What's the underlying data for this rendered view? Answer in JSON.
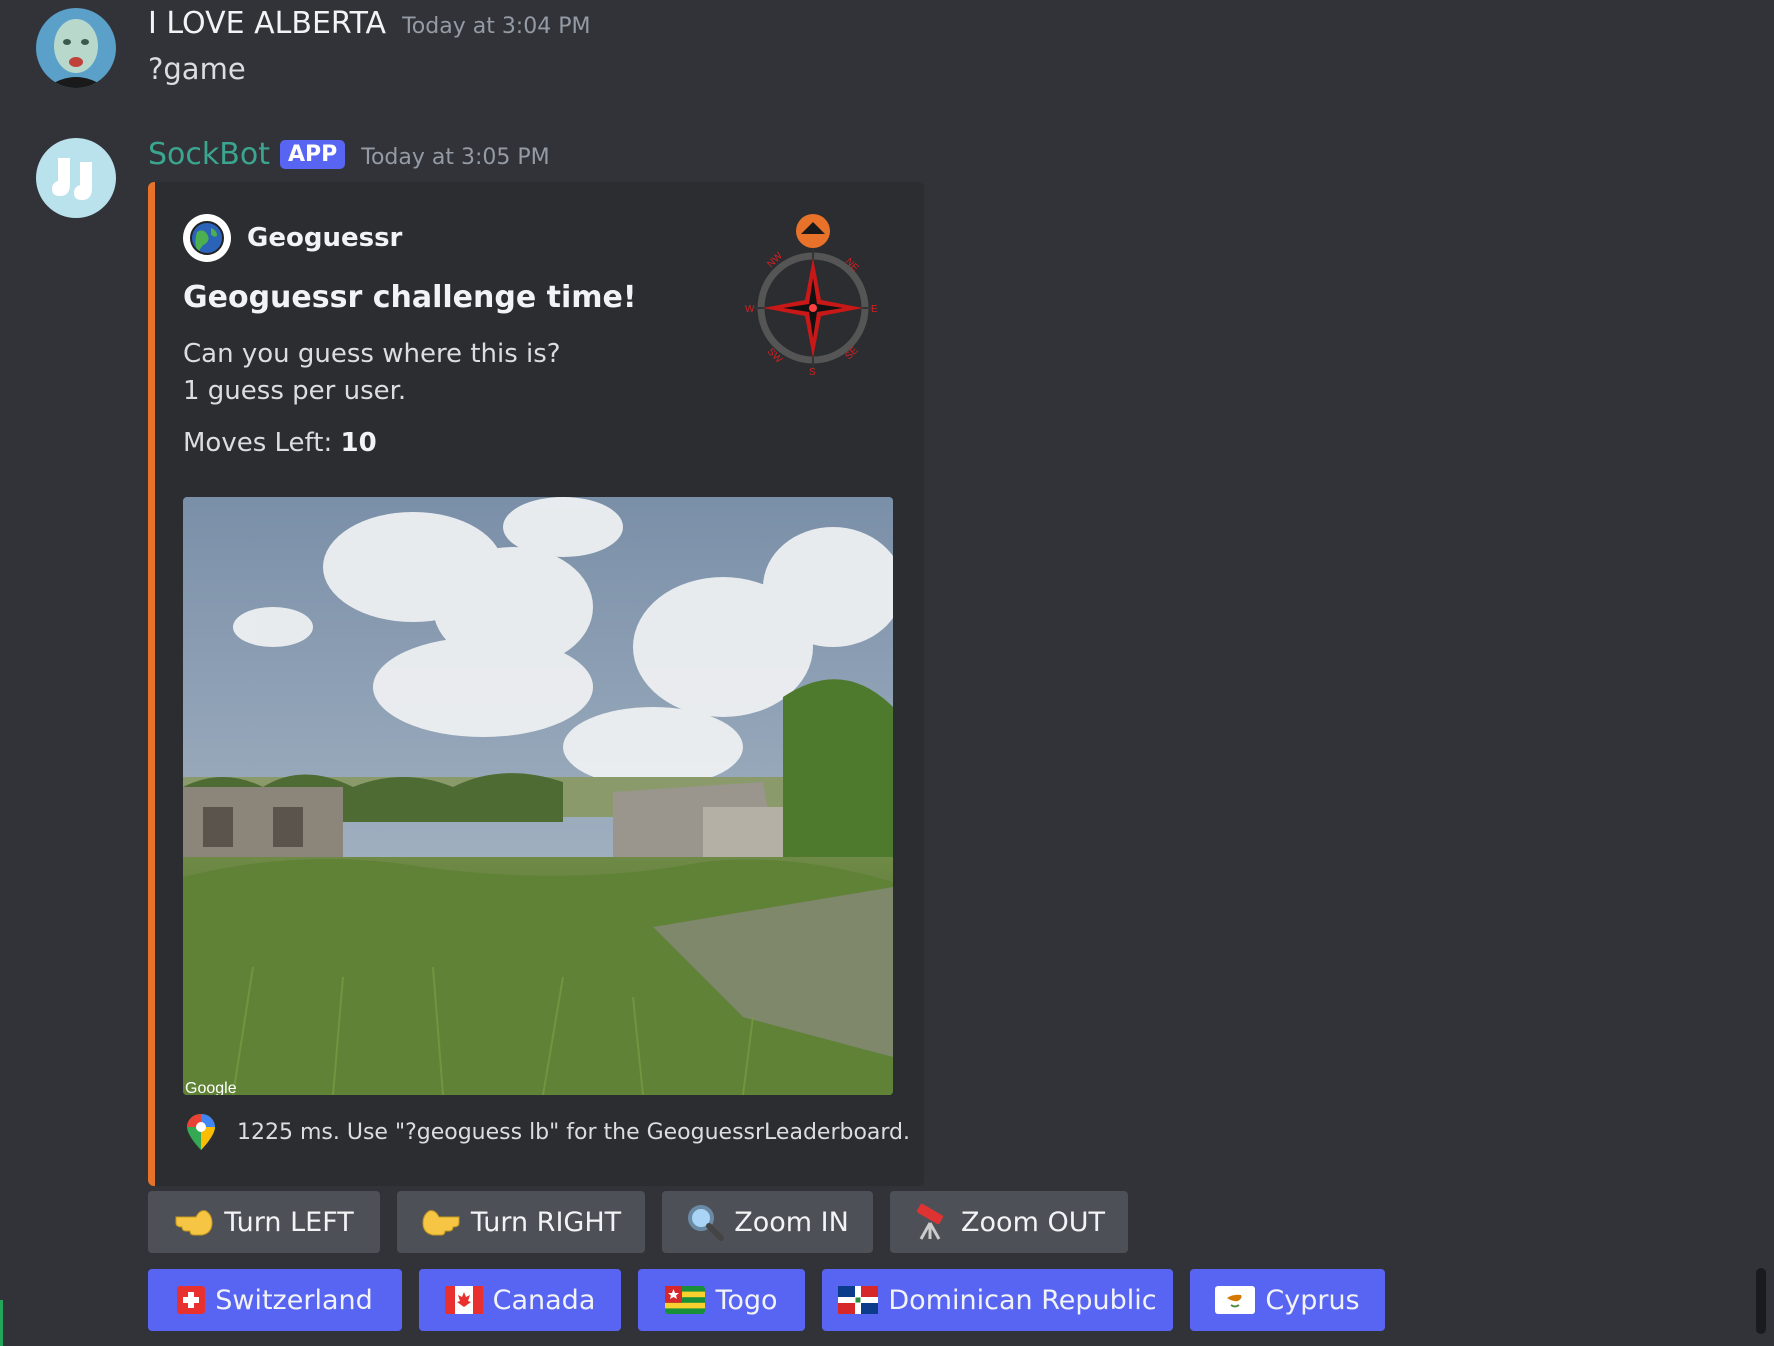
{
  "messages": [
    {
      "author": "I LOVE ALBERTA",
      "timestamp": "Today at 3:04 PM",
      "content": "?game"
    },
    {
      "author": "SockBot",
      "tag": "APP",
      "timestamp": "Today at 3:05 PM",
      "embed": {
        "accent_color": "#e8722a",
        "author_name": "Geoguessr",
        "title": "Geoguessr challenge time!",
        "description": "Can you guess where this is? 1 guess per user.",
        "moves_label": "Moves Left: ",
        "moves_value": "10",
        "footer": "1225 ms. Use \"?geoguess lb\" for the GeoguessrLeaderboard.",
        "compass_labels": [
          "NW",
          "NE",
          "W",
          "E",
          "SW",
          "SE",
          "S"
        ],
        "image_watermark": "Google"
      }
    }
  ],
  "controls": [
    {
      "label": "Turn LEFT",
      "icon": "pointing-left-hand-icon"
    },
    {
      "label": "Turn RIGHT",
      "icon": "pointing-right-hand-icon"
    },
    {
      "label": "Zoom IN",
      "icon": "magnifier-icon"
    },
    {
      "label": "Zoom OUT",
      "icon": "telescope-icon"
    }
  ],
  "guesses": [
    {
      "label": "Switzerland",
      "icon": "flag-switzerland-icon"
    },
    {
      "label": "Canada",
      "icon": "flag-canada-icon"
    },
    {
      "label": "Togo",
      "icon": "flag-togo-icon"
    },
    {
      "label": "Dominican Republic",
      "icon": "flag-dominican-republic-icon"
    },
    {
      "label": "Cyprus",
      "icon": "flag-cyprus-icon"
    }
  ],
  "colors": {
    "background": "#313338",
    "embed_background": "#2b2d31",
    "bot_name": "#3ba58f",
    "primary_button": "#5865f2",
    "secondary_button": "#4e5058"
  }
}
